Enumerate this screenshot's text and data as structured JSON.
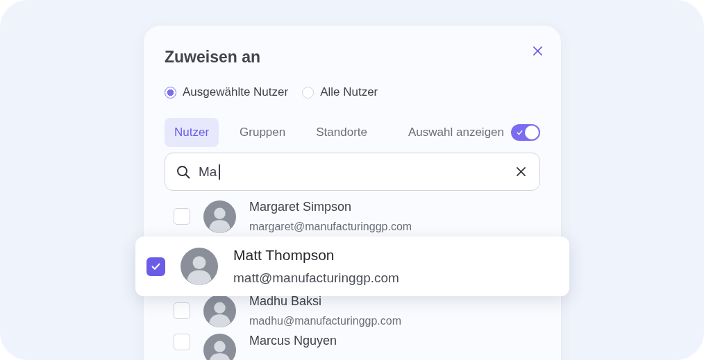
{
  "dialog": {
    "title": "Zuweisen an"
  },
  "scope_options": [
    {
      "label": "Ausgewählte Nutzer",
      "selected": true
    },
    {
      "label": "Alle Nutzer",
      "selected": false
    }
  ],
  "tabs": [
    {
      "label": "Nutzer",
      "selected": true
    },
    {
      "label": "Gruppen",
      "selected": false
    },
    {
      "label": "Standorte",
      "selected": false
    }
  ],
  "show_selection": {
    "label": "Auswahl anzeigen",
    "on": true
  },
  "search": {
    "value": "Ma"
  },
  "users": [
    {
      "name": "Margaret Simpson",
      "email": "margaret@manufacturinggp.com",
      "checked": false
    },
    {
      "name": "Matt Thompson",
      "email": "matt@manufacturinggp.com",
      "checked": true
    },
    {
      "name": "Madhu Baksi",
      "email": "madhu@manufacturinggp.com",
      "checked": false
    },
    {
      "name": "Marcus Nguyen",
      "checked": false
    }
  ]
}
